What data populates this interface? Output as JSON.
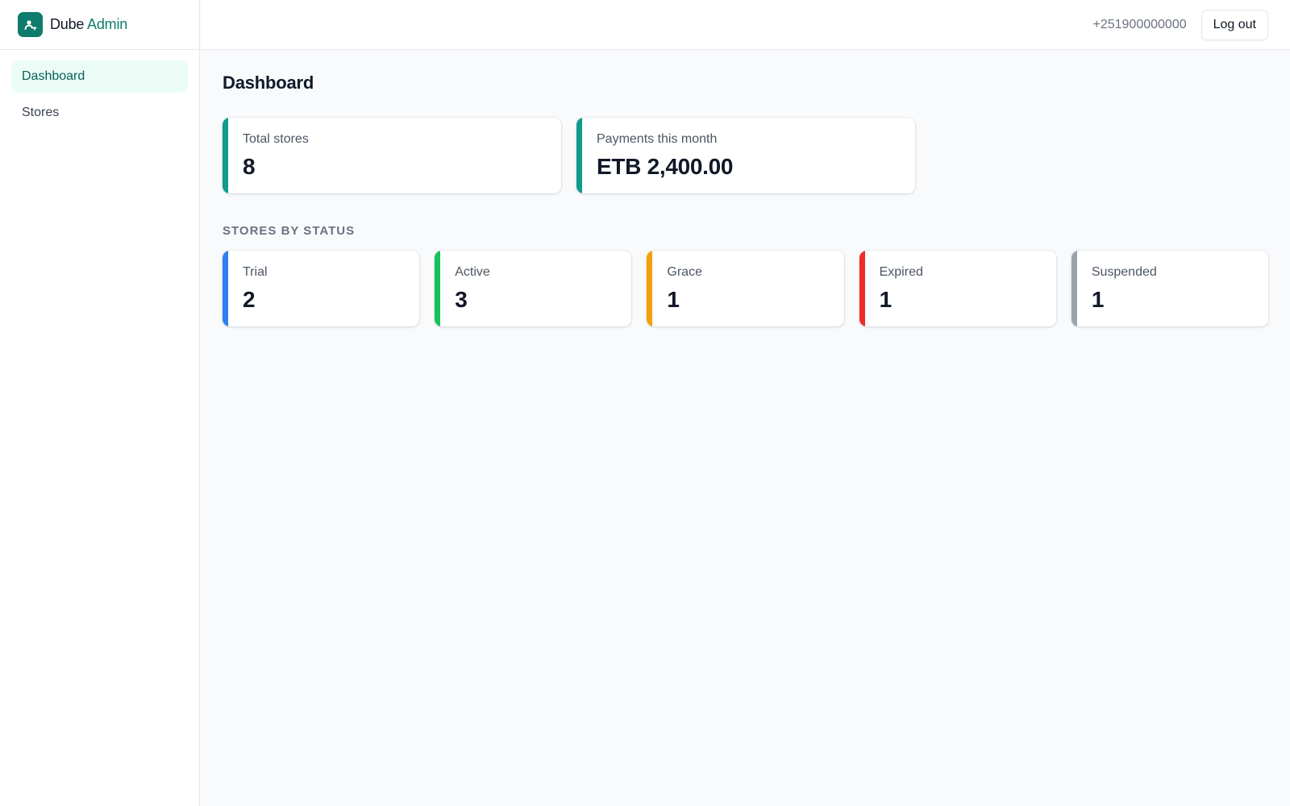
{
  "brand": {
    "name_primary": "Dube",
    "name_accent": "Admin",
    "logo_icon": "user-key-icon",
    "color": "#0f7b6c"
  },
  "nav": {
    "items": [
      {
        "label": "Dashboard",
        "active": true
      },
      {
        "label": "Stores",
        "active": false
      }
    ]
  },
  "header": {
    "phone": "+251900000000",
    "logout_label": "Log out"
  },
  "main": {
    "title": "Dashboard",
    "summary": [
      {
        "label": "Total stores",
        "value": "8",
        "color": "#0f9b8e"
      },
      {
        "label": "Payments this month",
        "value": "ETB 2,400.00",
        "color": "#0f9b8e"
      }
    ],
    "status_title": "STORES BY STATUS",
    "statuses": [
      {
        "label": "Trial",
        "value": "2",
        "color": "#2f7ff0"
      },
      {
        "label": "Active",
        "value": "3",
        "color": "#16c25a"
      },
      {
        "label": "Grace",
        "value": "1",
        "color": "#f59e0b"
      },
      {
        "label": "Expired",
        "value": "1",
        "color": "#ef2b2b"
      },
      {
        "label": "Suspended",
        "value": "1",
        "color": "#9ca3af"
      }
    ]
  }
}
